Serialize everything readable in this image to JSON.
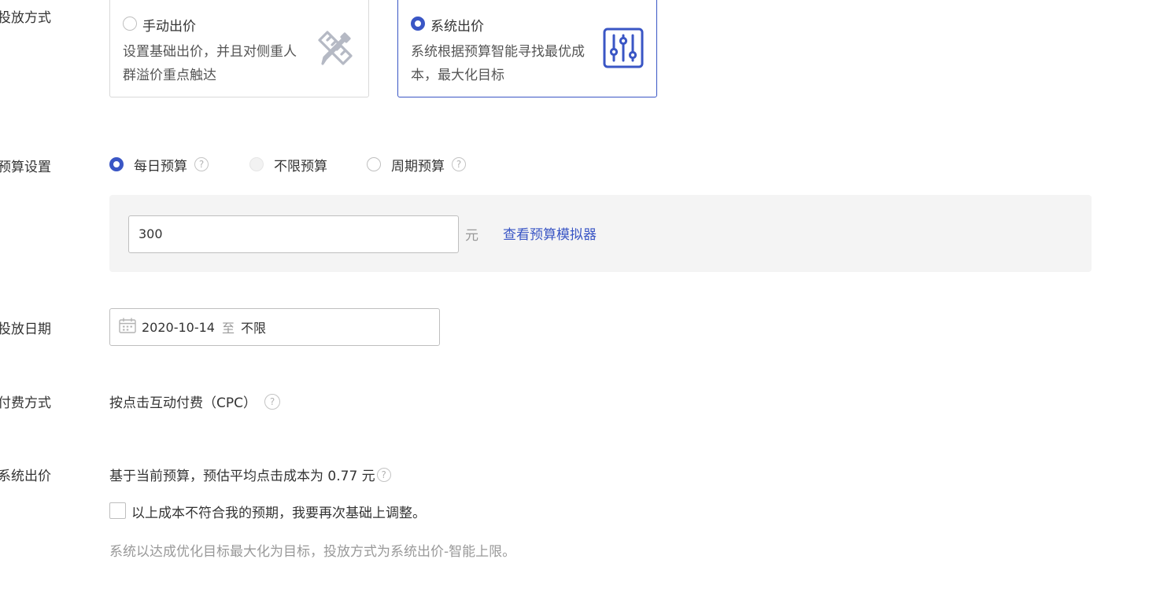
{
  "bidding": {
    "label": "投放方式",
    "manual": {
      "title": "手动出价",
      "desc": "设置基础出价，并且对侧重人群溢价重点触达",
      "icon": "pencil-ruler-icon",
      "selected": false
    },
    "system": {
      "title": "系统出价",
      "desc": "系统根据预算智能寻找最优成本，最大化目标",
      "icon": "sliders-icon",
      "selected": true
    }
  },
  "budget": {
    "label": "预算设置",
    "options": [
      {
        "label": "每日预算",
        "checked": true,
        "help": true
      },
      {
        "label": "不限预算",
        "checked": false,
        "disabled": true,
        "help": false
      },
      {
        "label": "周期预算",
        "checked": false,
        "help": true
      }
    ],
    "amount": "300",
    "unit": "元",
    "simulator_link": "查看预算模拟器"
  },
  "schedule": {
    "label": "投放日期",
    "start": "2020-10-14",
    "separator": "至",
    "end": "不限"
  },
  "payment": {
    "label": "付费方式",
    "value": "按点击互动付费（CPC）"
  },
  "system_bid": {
    "label": "系统出价",
    "estimate": "基于当前预算，预估平均点击成本为 0.77 元",
    "adjust_checkbox_label": "以上成本不符合我的预期，我要再次基础上调整。",
    "adjust_checked": false,
    "hint": "系统以达成优化目标最大化为目标，投放方式为系统出价-智能上限。"
  },
  "colors": {
    "accent": "#3a56c5",
    "text": "#333333",
    "muted": "#999999",
    "panel_bg": "#f4f4f4"
  }
}
